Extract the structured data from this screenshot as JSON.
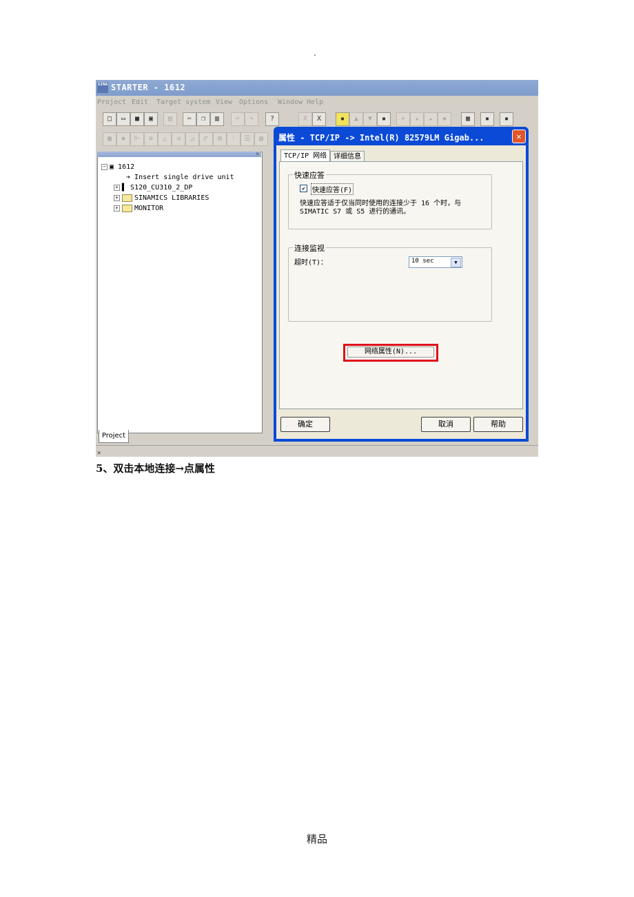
{
  "page": {
    "dot": ".",
    "caption": "5、双击本地连接→点属性",
    "footer": "精品"
  },
  "app": {
    "icon_text": "SINA",
    "title": "STARTER - 1612",
    "menu": [
      "Project",
      "Edit",
      "Target system",
      "View",
      "Options",
      "Window",
      "Help"
    ]
  },
  "tree": {
    "root": "1612",
    "items": [
      "Insert single drive unit",
      "S120_CU310_2_DP",
      "SINAMICS LIBRARIES",
      "MONITOR"
    ]
  },
  "project_tab": "Project",
  "status_x": "×",
  "dialog": {
    "title": "属性 - TCP/IP -> Intel(R) 82579LM Gigab...",
    "close_glyph": "✕",
    "tabs": [
      "TCP/IP 网络",
      "详细信息"
    ],
    "quick_ack": {
      "group_label": "快速应答",
      "checkbox_label": "快速应答(F)",
      "checked": true,
      "description_line1": "快速应答适于仅当同时使用的连接少于 16 个时，与",
      "description_line2": "SIMATIC S7 或 S5 进行的通讯。"
    },
    "connection": {
      "group_label": "连接监视",
      "timeout_label": "超时(T)：",
      "timeout_value": "10 sec"
    },
    "network_button": "网络属性(N)...",
    "ok": "确定",
    "cancel": "取消",
    "help": "帮助"
  },
  "colors": {
    "highlight": "#e0101a",
    "dialog_frame": "#0a4ad6"
  }
}
